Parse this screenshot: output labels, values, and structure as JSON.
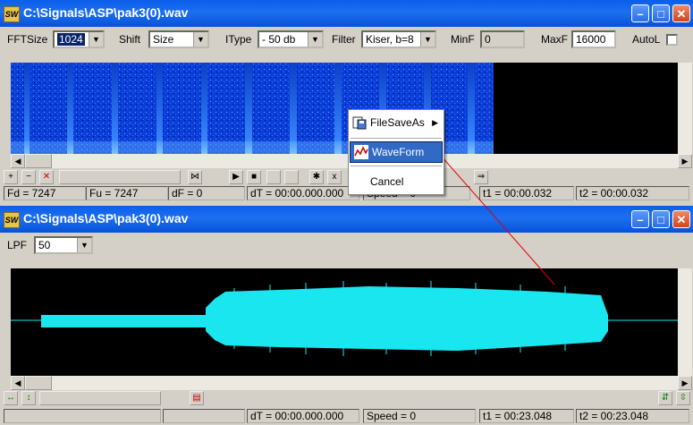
{
  "window1": {
    "title": "C:\\Signals\\ASP\\pak3(0).wav",
    "app_icon": "SW",
    "toolbar": {
      "fftsize_label": "FFTSize",
      "fftsize_value": "1024",
      "shift_label": "Shift",
      "shift_value": "Size",
      "itype_label": "IType",
      "itype_value": "- 50 db",
      "filter_label": "Filter",
      "filter_value": "Kiser, b=8",
      "minf_label": "MinF",
      "minf_value": "0",
      "maxf_label": "MaxF",
      "maxf_value": "16000",
      "autol_label": "AutoL"
    },
    "status": {
      "fd": "Fd = 7247",
      "fu": "Fu = 7247",
      "df": "dF = 0",
      "dt": "dT = 00:00.000.000",
      "speed": "Speed = 0",
      "t1": "t1 = 00:00.032",
      "t2": "t2 = 00:00.032"
    }
  },
  "context_menu": {
    "items": [
      {
        "label": "FileSaveAs",
        "icon": "save-as-icon",
        "submenu": true
      },
      {
        "label": "WaveForm",
        "icon": "waveform-icon",
        "highlighted": true
      },
      {
        "label": "Cancel"
      }
    ]
  },
  "window2": {
    "title": "C:\\Signals\\ASP\\pak3(0).wav",
    "app_icon": "SW",
    "toolbar": {
      "lpf_label": "LPF",
      "lpf_value": "50"
    },
    "status": {
      "dt": "dT = 00:00.000.000",
      "speed": "Speed = 0",
      "t1": "t1 = 00:23.048",
      "t2": "t2 = 00:23.048"
    }
  },
  "colors": {
    "spectrogram_bg": "#0a3ed8",
    "waveform": "#19e6ee",
    "titlebar": "#0a5ee8",
    "pointer_line": "#e00000"
  }
}
